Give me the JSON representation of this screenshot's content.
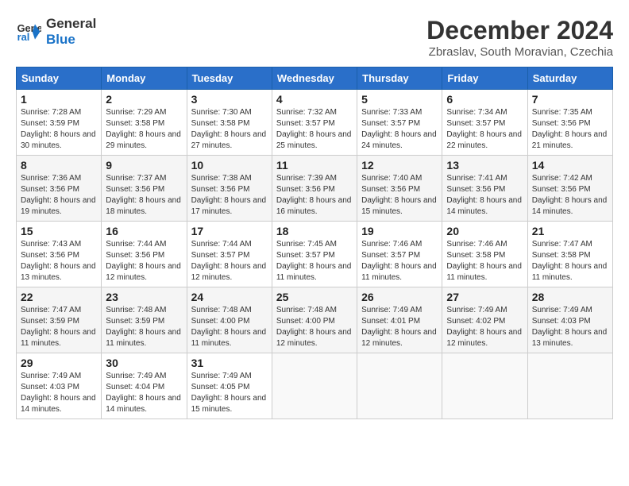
{
  "logo": {
    "line1": "General",
    "line2": "Blue"
  },
  "title": "December 2024",
  "location": "Zbraslav, South Moravian, Czechia",
  "weekdays": [
    "Sunday",
    "Monday",
    "Tuesday",
    "Wednesday",
    "Thursday",
    "Friday",
    "Saturday"
  ],
  "weeks": [
    [
      {
        "day": "1",
        "sunrise": "7:28 AM",
        "sunset": "3:59 PM",
        "daylight": "8 hours and 30 minutes."
      },
      {
        "day": "2",
        "sunrise": "7:29 AM",
        "sunset": "3:58 PM",
        "daylight": "8 hours and 29 minutes."
      },
      {
        "day": "3",
        "sunrise": "7:30 AM",
        "sunset": "3:58 PM",
        "daylight": "8 hours and 27 minutes."
      },
      {
        "day": "4",
        "sunrise": "7:32 AM",
        "sunset": "3:57 PM",
        "daylight": "8 hours and 25 minutes."
      },
      {
        "day": "5",
        "sunrise": "7:33 AM",
        "sunset": "3:57 PM",
        "daylight": "8 hours and 24 minutes."
      },
      {
        "day": "6",
        "sunrise": "7:34 AM",
        "sunset": "3:57 PM",
        "daylight": "8 hours and 22 minutes."
      },
      {
        "day": "7",
        "sunrise": "7:35 AM",
        "sunset": "3:56 PM",
        "daylight": "8 hours and 21 minutes."
      }
    ],
    [
      {
        "day": "8",
        "sunrise": "7:36 AM",
        "sunset": "3:56 PM",
        "daylight": "8 hours and 19 minutes."
      },
      {
        "day": "9",
        "sunrise": "7:37 AM",
        "sunset": "3:56 PM",
        "daylight": "8 hours and 18 minutes."
      },
      {
        "day": "10",
        "sunrise": "7:38 AM",
        "sunset": "3:56 PM",
        "daylight": "8 hours and 17 minutes."
      },
      {
        "day": "11",
        "sunrise": "7:39 AM",
        "sunset": "3:56 PM",
        "daylight": "8 hours and 16 minutes."
      },
      {
        "day": "12",
        "sunrise": "7:40 AM",
        "sunset": "3:56 PM",
        "daylight": "8 hours and 15 minutes."
      },
      {
        "day": "13",
        "sunrise": "7:41 AM",
        "sunset": "3:56 PM",
        "daylight": "8 hours and 14 minutes."
      },
      {
        "day": "14",
        "sunrise": "7:42 AM",
        "sunset": "3:56 PM",
        "daylight": "8 hours and 14 minutes."
      }
    ],
    [
      {
        "day": "15",
        "sunrise": "7:43 AM",
        "sunset": "3:56 PM",
        "daylight": "8 hours and 13 minutes."
      },
      {
        "day": "16",
        "sunrise": "7:44 AM",
        "sunset": "3:56 PM",
        "daylight": "8 hours and 12 minutes."
      },
      {
        "day": "17",
        "sunrise": "7:44 AM",
        "sunset": "3:57 PM",
        "daylight": "8 hours and 12 minutes."
      },
      {
        "day": "18",
        "sunrise": "7:45 AM",
        "sunset": "3:57 PM",
        "daylight": "8 hours and 11 minutes."
      },
      {
        "day": "19",
        "sunrise": "7:46 AM",
        "sunset": "3:57 PM",
        "daylight": "8 hours and 11 minutes."
      },
      {
        "day": "20",
        "sunrise": "7:46 AM",
        "sunset": "3:58 PM",
        "daylight": "8 hours and 11 minutes."
      },
      {
        "day": "21",
        "sunrise": "7:47 AM",
        "sunset": "3:58 PM",
        "daylight": "8 hours and 11 minutes."
      }
    ],
    [
      {
        "day": "22",
        "sunrise": "7:47 AM",
        "sunset": "3:59 PM",
        "daylight": "8 hours and 11 minutes."
      },
      {
        "day": "23",
        "sunrise": "7:48 AM",
        "sunset": "3:59 PM",
        "daylight": "8 hours and 11 minutes."
      },
      {
        "day": "24",
        "sunrise": "7:48 AM",
        "sunset": "4:00 PM",
        "daylight": "8 hours and 11 minutes."
      },
      {
        "day": "25",
        "sunrise": "7:48 AM",
        "sunset": "4:00 PM",
        "daylight": "8 hours and 12 minutes."
      },
      {
        "day": "26",
        "sunrise": "7:49 AM",
        "sunset": "4:01 PM",
        "daylight": "8 hours and 12 minutes."
      },
      {
        "day": "27",
        "sunrise": "7:49 AM",
        "sunset": "4:02 PM",
        "daylight": "8 hours and 12 minutes."
      },
      {
        "day": "28",
        "sunrise": "7:49 AM",
        "sunset": "4:03 PM",
        "daylight": "8 hours and 13 minutes."
      }
    ],
    [
      {
        "day": "29",
        "sunrise": "7:49 AM",
        "sunset": "4:03 PM",
        "daylight": "8 hours and 14 minutes."
      },
      {
        "day": "30",
        "sunrise": "7:49 AM",
        "sunset": "4:04 PM",
        "daylight": "8 hours and 14 minutes."
      },
      {
        "day": "31",
        "sunrise": "7:49 AM",
        "sunset": "4:05 PM",
        "daylight": "8 hours and 15 minutes."
      },
      null,
      null,
      null,
      null
    ]
  ]
}
